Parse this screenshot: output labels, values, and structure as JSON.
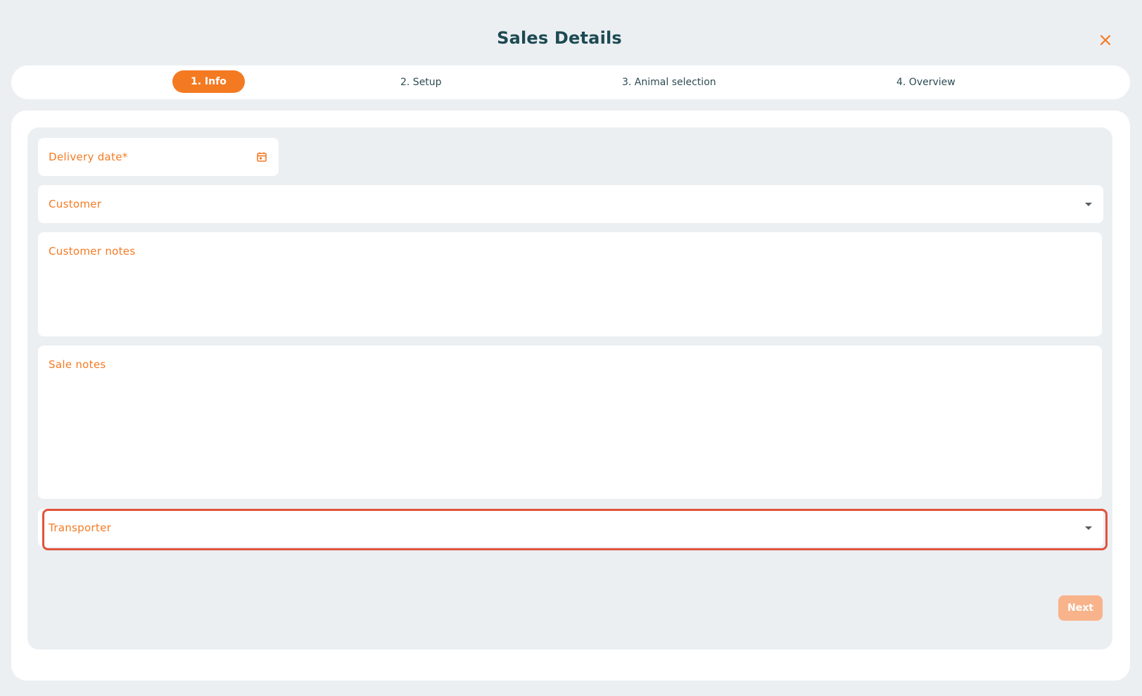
{
  "dialog": {
    "title": "Sales Details",
    "close_icon": "close-icon"
  },
  "stepper": {
    "steps": [
      {
        "label": "1. Info",
        "active": true
      },
      {
        "label": "2. Setup",
        "active": false
      },
      {
        "label": "3. Animal selection",
        "active": false
      },
      {
        "label": "4. Overview",
        "active": false
      }
    ]
  },
  "form": {
    "delivery_date": {
      "label": "Delivery date*",
      "icon": "calendar-icon"
    },
    "customer": {
      "label": "Customer",
      "icon": "chevron-down-icon"
    },
    "customer_notes": {
      "label": "Customer notes"
    },
    "sale_notes": {
      "label": "Sale notes"
    },
    "transporter": {
      "label": "Transporter",
      "icon": "chevron-down-icon"
    },
    "next_label": "Next"
  },
  "colors": {
    "accent": "#f47a22",
    "title": "#1d4a52",
    "background": "#eceff2",
    "highlight": "#e0533c",
    "next_disabled": "#f8b38a"
  }
}
